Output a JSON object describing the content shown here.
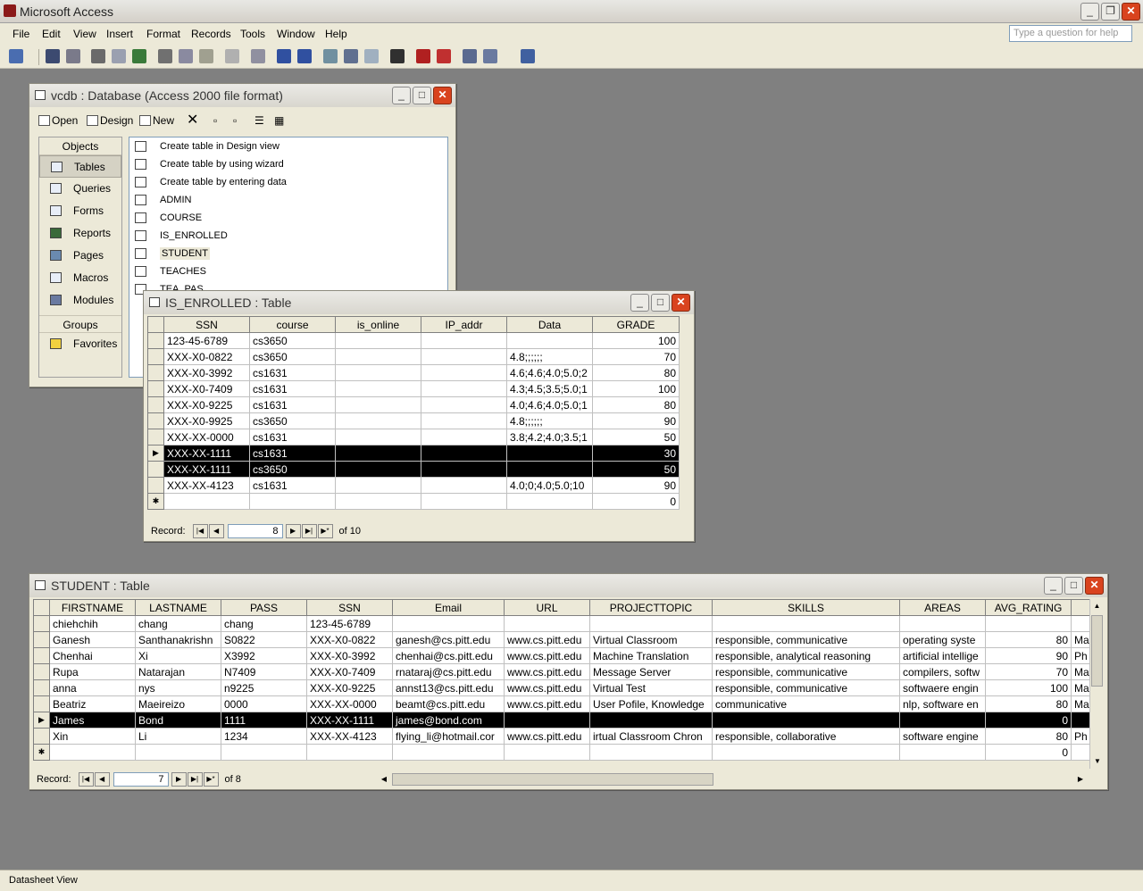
{
  "app": {
    "title": "Microsoft Access"
  },
  "menu": [
    "File",
    "Edit",
    "View",
    "Insert",
    "Format",
    "Records",
    "Tools",
    "Window",
    "Help"
  ],
  "help_placeholder": "Type a question for help",
  "db_window": {
    "title": "vcdb : Database (Access 2000 file format)",
    "toolbar": {
      "open": "Open",
      "design": "Design",
      "new": "New"
    },
    "objects_header": "Objects",
    "objects": [
      "Tables",
      "Queries",
      "Forms",
      "Reports",
      "Pages",
      "Macros",
      "Modules"
    ],
    "groups_header": "Groups",
    "favorites": "Favorites",
    "items": [
      "Create table in Design view",
      "Create table by using wizard",
      "Create table by entering data",
      "ADMIN",
      "COURSE",
      "IS_ENROLLED",
      "STUDENT",
      "TEACHES",
      "TEA_PAS"
    ]
  },
  "enrolled": {
    "title": "IS_ENROLLED : Table",
    "columns": [
      "SSN",
      "course",
      "is_online",
      "IP_addr",
      "Data",
      "GRADE"
    ],
    "rows": [
      [
        "123-45-6789",
        "cs3650",
        "",
        "",
        "",
        "100"
      ],
      [
        "XXX-X0-0822",
        "cs3650",
        "",
        "",
        "4.8;;;;;;",
        "70"
      ],
      [
        "XXX-X0-3992",
        "cs1631",
        "",
        "",
        "4.6;4.6;4.0;5.0;2",
        "80"
      ],
      [
        "XXX-X0-7409",
        "cs1631",
        "",
        "",
        "4.3;4.5;3.5;5.0;1",
        "100"
      ],
      [
        "XXX-X0-9225",
        "cs1631",
        "",
        "",
        "4.0;4.6;4.0;5.0;1",
        "80"
      ],
      [
        "XXX-X0-9925",
        "cs3650",
        "",
        "",
        "4.8;;;;;;",
        "90"
      ],
      [
        "XXX-XX-0000",
        "cs1631",
        "",
        "",
        "3.8;4.2;4.0;3.5;1",
        "50"
      ],
      [
        "XXX-XX-1111",
        "cs1631",
        "",
        "",
        "",
        "30"
      ],
      [
        "XXX-XX-1111",
        "cs3650",
        "",
        "",
        "",
        "50"
      ],
      [
        "XXX-XX-4123",
        "cs1631",
        "",
        "",
        "4.0;0;4.0;5.0;10",
        "90"
      ],
      [
        "",
        "",
        "",
        "",
        "",
        "0"
      ]
    ],
    "record_label": "Record:",
    "record_current": "8",
    "record_of": "of  10"
  },
  "student": {
    "title": "STUDENT : Table",
    "columns": [
      "FIRSTNAME",
      "LASTNAME",
      "PASS",
      "SSN",
      "Email",
      "URL",
      "PROJECTTOPIC",
      "SKILLS",
      "AREAS",
      "AVG_RATING",
      ""
    ],
    "rows": [
      [
        "chiehchih",
        "chang",
        "chang",
        "123-45-6789",
        "",
        "",
        "",
        "",
        "",
        "",
        ""
      ],
      [
        "Ganesh",
        "Santhanakrishn",
        "S0822",
        "XXX-X0-0822",
        "ganesh@cs.pitt.edu",
        "www.cs.pitt.edu",
        "Virtual Classroom",
        "responsible, communicative",
        "operating syste",
        "80",
        "Ma"
      ],
      [
        "Chenhai",
        "Xi",
        "X3992",
        "XXX-X0-3992",
        "chenhai@cs.pitt.edu",
        "www.cs.pitt.edu",
        "Machine Translation",
        "responsible, analytical reasoning",
        "artificial intellige",
        "90",
        "Ph"
      ],
      [
        "Rupa",
        "Natarajan",
        "N7409",
        "XXX-X0-7409",
        "rnataraj@cs.pitt.edu",
        "www.cs.pitt.edu",
        "Message Server",
        "responsible, communicative",
        "compilers, softw",
        "70",
        "Ma"
      ],
      [
        "anna",
        "nys",
        "n9225",
        "XXX-X0-9225",
        "annst13@cs.pitt.edu",
        "www.cs.pitt.edu",
        "Virtual Test",
        "responsible, communicative",
        "softwaere engin",
        "100",
        "Ma"
      ],
      [
        "Beatriz",
        "Maeireizo",
        "0000",
        "XXX-XX-0000",
        "beamt@cs.pitt.edu",
        "www.cs.pitt.edu",
        "User Pofile, Knowledge",
        "communicative",
        "nlp, software en",
        "80",
        "Ma"
      ],
      [
        "James",
        "Bond",
        "1111",
        "XXX-XX-1111",
        "james@bond.com",
        "",
        "",
        "",
        "",
        "0",
        ""
      ],
      [
        "Xin",
        "Li",
        "1234",
        "XXX-XX-4123",
        "flying_li@hotmail.cor",
        "www.cs.pitt.edu",
        "irtual Classroom Chron",
        "responsible, collaborative",
        "software engine",
        "80",
        "Ph"
      ],
      [
        "",
        "",
        "",
        "",
        "",
        "",
        "",
        "",
        "",
        "0",
        ""
      ]
    ],
    "record_label": "Record:",
    "record_current": "7",
    "record_of": "of  8"
  },
  "status": "Datasheet View"
}
